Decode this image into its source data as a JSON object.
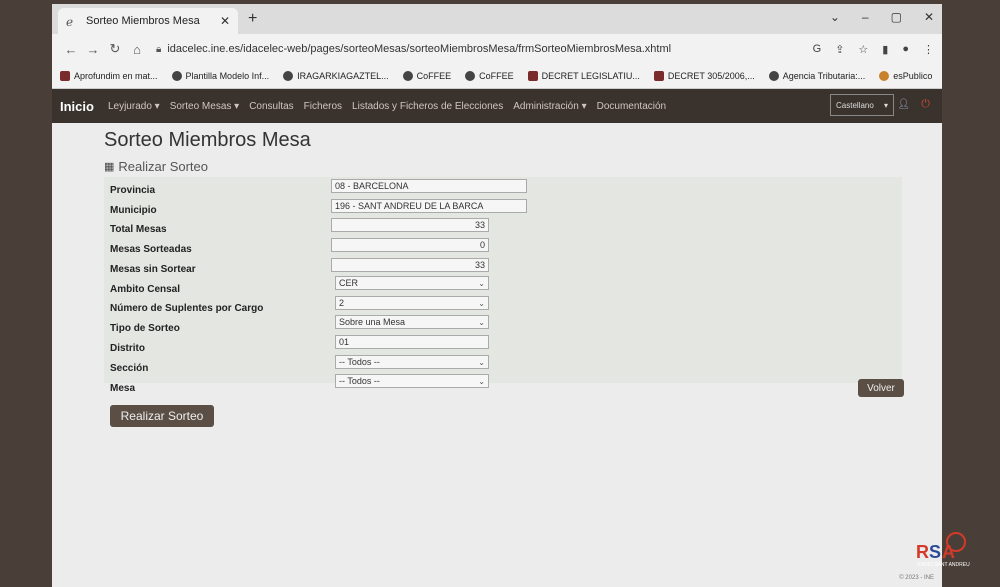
{
  "browser": {
    "tab_title": "Sorteo Miembros Mesa",
    "url": "idacelec.ine.es/idacelec-web/pages/sorteoMesas/sorteoMiembrosMesa/frmSorteoMiembrosMesa.xhtml",
    "bookmarks": [
      "Aprofundim en mat...",
      "Plantilla Modelo Inf...",
      "IRAGARKIAGAZTEL...",
      "CoFFEE",
      "CoFFEE",
      "DECRET LEGISLATIU...",
      "DECRET 305/2006,...",
      "Agencia Tributaria:...",
      "esPublico"
    ]
  },
  "navbar": {
    "brand": "Inicio",
    "items": [
      "Leyjurado",
      "Sorteo Mesas",
      "Consultas",
      "Ficheros",
      "Listados y Ficheros de Elecciones",
      "Administración",
      "Documentación"
    ],
    "language": "Castellano"
  },
  "page": {
    "title": "Sorteo Miembros Mesa",
    "section": "Realizar Sorteo"
  },
  "form": {
    "provincia_label": "Provincia",
    "provincia_value": "08 - BARCELONA",
    "municipio_label": "Municipio",
    "municipio_value": "196 - SANT ANDREU DE LA BARCA",
    "total_mesas_label": "Total Mesas",
    "total_mesas_value": "33",
    "mesas_sorteadas_label": "Mesas Sorteadas",
    "mesas_sorteadas_value": "0",
    "mesas_sin_sortear_label": "Mesas sin Sortear",
    "mesas_sin_sortear_value": "33",
    "ambito_label": "Ambito Censal",
    "ambito_value": "CER",
    "suplentes_label": "Número de Suplentes por Cargo",
    "suplentes_value": "2",
    "tipo_label": "Tipo de Sorteo",
    "tipo_value": "Sobre una Mesa",
    "distrito_label": "Distrito",
    "distrito_value": "01",
    "seccion_label": "Sección",
    "seccion_value": "-- Todos --",
    "mesa_label": "Mesa",
    "mesa_value": "-- Todos --"
  },
  "buttons": {
    "volver": "Volver",
    "realizar": "Realizar Sorteo"
  },
  "footer": "© 2023 - INE",
  "watermark": "RSA RADIO SANT ANDREU"
}
